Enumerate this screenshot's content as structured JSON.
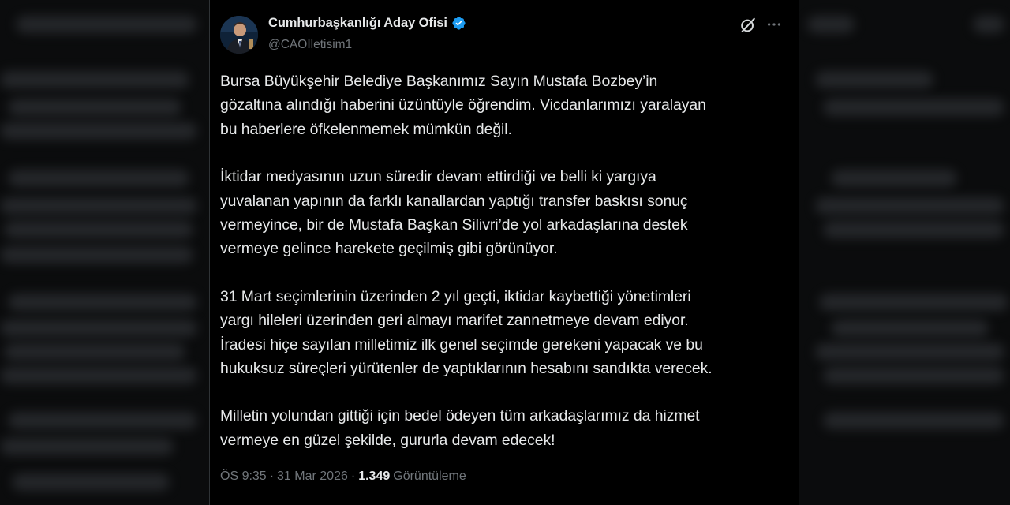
{
  "tweet": {
    "author": {
      "display_name": "Cumhurbaşkanlığı Aday Ofisi",
      "handle": "@CAOIletisim1",
      "verified": true,
      "avatar_icon": "profile-photo"
    },
    "actions": {
      "grok_icon": "grok-icon",
      "more_icon": "more-options-icon"
    },
    "paragraphs": [
      "Bursa Büyükşehir Belediye Başkanımız Sayın Mustafa Bozbey’in\ngözaltına alındığı haberini üzüntüyle öğrendim. Vicdanlarımızı yaralayan\nbu haberlere öfkelenmemek mümkün değil.",
      "İktidar medyasının uzun süredir devam ettirdiği ve belli ki yargıya\nyuvalanan yapının da farklı kanallardan yaptığı transfer baskısı sonuç\nvermeyince, bir de Mustafa Başkan Silivri’de yol arkadaşlarına destek\nvermeye gelince harekete geçilmiş gibi görünüyor.",
      "31 Mart seçimlerinin üzerinden 2 yıl geçti, iktidar kaybettiği yönetimleri\nyargı hileleri üzerinden geri almayı marifet zannetmeye devam ediyor.\nİradesi hiçe sayılan milletimiz ilk genel seçimde gerekeni yapacak ve bu\nhukuksuz süreçleri yürütenler de yaptıklarının hesabını sandıkta verecek.",
      "Milletin yolundan gittiği için bedel ödeyen tüm arkadaşlarımız da hizmet\nvermeye en güzel şekilde, gururla devam edecek!"
    ],
    "meta": {
      "time": "ÖS 9:35",
      "separator": "·",
      "date": "31 Mar 2026",
      "views_count": "1.349",
      "views_label": "Görüntüleme"
    }
  },
  "colors": {
    "background": "#000000",
    "text_primary": "#e7e9ea",
    "text_secondary": "#71767b",
    "verified_blue": "#1d9bf0",
    "border": "#2f3336"
  }
}
